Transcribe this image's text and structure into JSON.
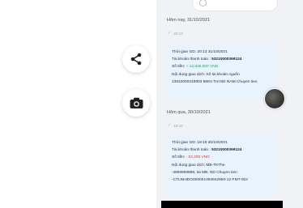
{
  "search": {
    "placeholder": ""
  },
  "groups": [
    {
      "date": "Hôm nay, 31/10/2021",
      "time": "20:13",
      "lines": {
        "time_label": "Thời gian GD:",
        "time_value": "20:13 31/10/2021",
        "account_label": "Tài khoản thanh toán :",
        "account_value": "53210000369124",
        "amount_label": "Số tiền:",
        "amount_value": "+ 12,845,000 VND",
        "content_1": "Nội dung giao dịch: Số tài khoản nguồn",
        "content_2": "13810000318903 BIEN THI BE NAM Chuyen tien"
      }
    },
    {
      "date": "Hôm qua, 30/10/2021",
      "time": "18:18",
      "lines": {
        "time_label": "Thời gian GD:",
        "time_value": "18:18 30/10/2021",
        "account_label": "Tài khoản thanh toán :",
        "account_value": "53210000369124",
        "amount_label": "Số tiền:",
        "amount_value": "- 52,200 VND",
        "content_1": "Nội dung giao dịch: MB-TKThe",
        "content_2": ":4999968888, tai MB. ND Chuyen tien",
        "content_3": "-CTLNHIDO000001494942950-12-FMT-002"
      }
    }
  ],
  "icons": {
    "share": "share-icon",
    "camera": "camera-icon"
  }
}
